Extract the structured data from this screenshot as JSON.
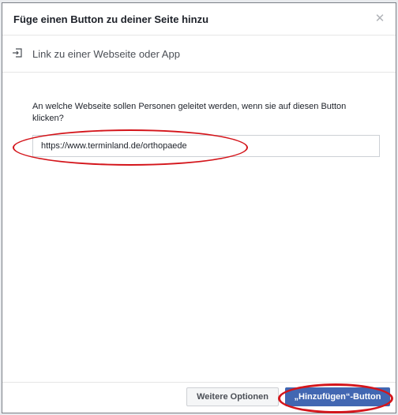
{
  "dialog": {
    "title": "Füge einen Button zu deiner Seite hinzu",
    "close_icon": "close-icon",
    "subtitle": "Link zu einer Webseite oder App",
    "subtitle_icon": "link-arrow-icon",
    "question": "An welche Webseite sollen Personen geleitet werden, wenn sie auf diesen Button klicken?",
    "url_value": "https://www.terminland.de/orthopaede",
    "buttons": {
      "more_options": "Weitere Optionen",
      "add": "„Hinzufügen“-Button"
    }
  },
  "colors": {
    "primary": "#4267b2",
    "annotation": "#d4151b"
  }
}
